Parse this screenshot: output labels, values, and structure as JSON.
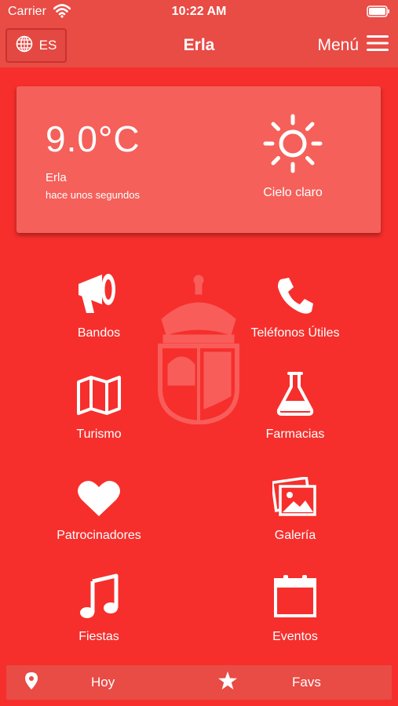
{
  "status_bar": {
    "carrier": "Carrier",
    "time": "10:22 AM",
    "icons": [
      "wifi-icon",
      "battery-icon"
    ]
  },
  "nav": {
    "language": "ES",
    "title": "Erla",
    "menu_label": "Menú",
    "icons": [
      "globe-icon",
      "hamburger-icon"
    ]
  },
  "weather": {
    "temperature": "9.0°C",
    "location": "Erla",
    "updated": "hace unos segundos",
    "condition": "Cielo claro",
    "icon": "sun-icon"
  },
  "grid": [
    {
      "label": "Bandos",
      "icon": "megaphone-icon"
    },
    {
      "label": "Teléfonos Útiles",
      "icon": "phone-icon"
    },
    {
      "label": "Turismo",
      "icon": "map-icon"
    },
    {
      "label": "Farmacias",
      "icon": "flask-icon"
    },
    {
      "label": "Patrocinadores",
      "icon": "heart-icon"
    },
    {
      "label": "Galería",
      "icon": "gallery-icon"
    },
    {
      "label": "Fiestas",
      "icon": "music-note-icon"
    },
    {
      "label": "Eventos",
      "icon": "calendar-icon"
    }
  ],
  "tabs": [
    {
      "label": "Hoy",
      "icon": "location-pin-icon"
    },
    {
      "label": "Favs",
      "icon": "star-icon"
    }
  ],
  "colors": {
    "background": "#f62f2c",
    "bar": "#e94b45",
    "card": "#f5605a",
    "text": "#ffffff"
  }
}
